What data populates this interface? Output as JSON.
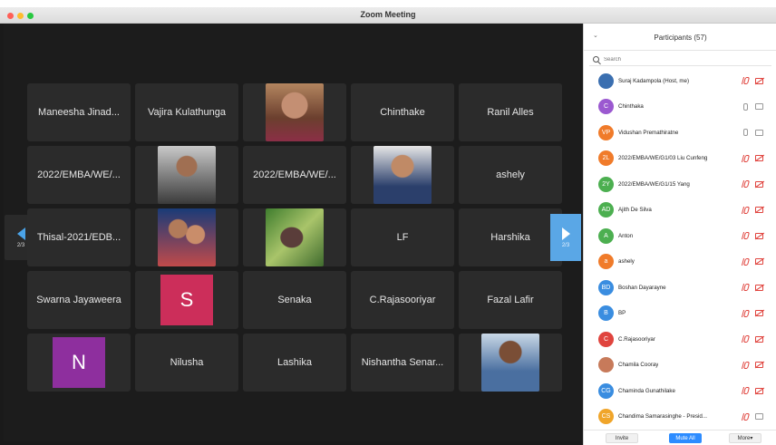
{
  "window": {
    "title": "Zoom Meeting"
  },
  "colors": {
    "accent": "#2d8cff",
    "mute_red": "#e0443e",
    "tile_bg": "#2b2b2b"
  },
  "gallery": {
    "page_left": "2/3",
    "page_right": "2/3",
    "tiles": [
      {
        "type": "name",
        "label": "Maneesha Jinad..."
      },
      {
        "type": "name",
        "label": "Vajira Kulathunga"
      },
      {
        "type": "photo",
        "label": ""
      },
      {
        "type": "name",
        "label": "Chinthake"
      },
      {
        "type": "name",
        "label": "Ranil Alles"
      },
      {
        "type": "name",
        "label": "2022/EMBA/WE/..."
      },
      {
        "type": "photo",
        "label": ""
      },
      {
        "type": "name",
        "label": "2022/EMBA/WE/..."
      },
      {
        "type": "photo",
        "label": ""
      },
      {
        "type": "name",
        "label": "ashely"
      },
      {
        "type": "name",
        "label": "Thisal-2021/EDB..."
      },
      {
        "type": "photo",
        "label": ""
      },
      {
        "type": "photo",
        "label": ""
      },
      {
        "type": "name",
        "label": "LF"
      },
      {
        "type": "name",
        "label": "Harshika"
      },
      {
        "type": "name",
        "label": "Swarna Jayaweera"
      },
      {
        "type": "letter",
        "label": "S",
        "color": "#cc2e5a"
      },
      {
        "type": "name",
        "label": "Senaka"
      },
      {
        "type": "name",
        "label": "C.Rajasooriyar"
      },
      {
        "type": "name",
        "label": "Fazal Lafir"
      },
      {
        "type": "letter",
        "label": "N",
        "color": "#8e2f9e"
      },
      {
        "type": "name",
        "label": "Nilusha"
      },
      {
        "type": "name",
        "label": "Lashika"
      },
      {
        "type": "name",
        "label": "Nishantha Senar..."
      },
      {
        "type": "photo",
        "label": ""
      }
    ]
  },
  "participants": {
    "title": "Participants (57)",
    "search_placeholder": "Search",
    "list": [
      {
        "initials": "",
        "name": "Suraj Kadampola (Host, me)",
        "color": "#3b6fb0",
        "mic": "red",
        "cam": "red"
      },
      {
        "initials": "C",
        "name": "Chinthaka",
        "color": "#9b59d0",
        "mic": "grey",
        "cam": "grey"
      },
      {
        "initials": "VP",
        "name": "Vidushan Premathiratne",
        "color": "#f07b2a",
        "mic": "grey",
        "cam": "grey"
      },
      {
        "initials": "2L",
        "name": "2022/EMBA/WE/G1/03 Liu Cunfeng",
        "color": "#f07b2a",
        "mic": "red",
        "cam": "red"
      },
      {
        "initials": "2Y",
        "name": "2022/EMBA/WE/G1/15 Yang",
        "color": "#4caf50",
        "mic": "red",
        "cam": "red"
      },
      {
        "initials": "AD",
        "name": "Ajith De Silva",
        "color": "#4caf50",
        "mic": "red",
        "cam": "red"
      },
      {
        "initials": "A",
        "name": "Anton",
        "color": "#4caf50",
        "mic": "red",
        "cam": "red"
      },
      {
        "initials": "a",
        "name": "ashely",
        "color": "#f07b2a",
        "mic": "red",
        "cam": "red"
      },
      {
        "initials": "BD",
        "name": "Boshan Dayarayne",
        "color": "#3a8de0",
        "mic": "red",
        "cam": "red"
      },
      {
        "initials": "B",
        "name": "BP",
        "color": "#3a8de0",
        "mic": "red",
        "cam": "red"
      },
      {
        "initials": "C",
        "name": "C.Rajasooriyar",
        "color": "#e0443e",
        "mic": "red",
        "cam": "red"
      },
      {
        "initials": "",
        "name": "Chamila Cooray",
        "color": "#c77a5a",
        "mic": "red",
        "cam": "red"
      },
      {
        "initials": "CG",
        "name": "Chaminda Gunathilake",
        "color": "#3a8de0",
        "mic": "red",
        "cam": "red"
      },
      {
        "initials": "CS",
        "name": "Chandima Samarasinghe - Presid...",
        "color": "#f0a52a",
        "mic": "red",
        "cam": "grey"
      }
    ],
    "footer": {
      "invite": "Invite",
      "mute_all": "Mute All",
      "more": "More▾"
    }
  }
}
